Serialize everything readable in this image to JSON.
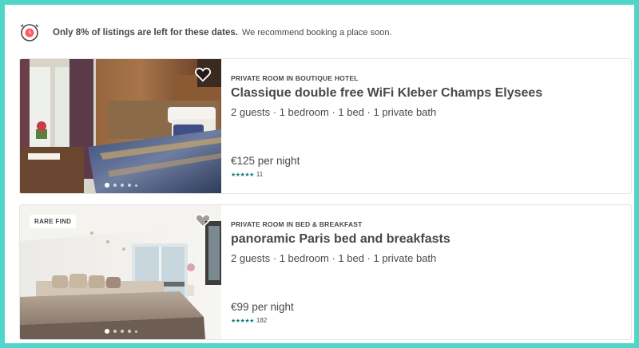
{
  "notice": {
    "icon": "clock-alert-icon",
    "strong": "Only 8% of listings are left for these dates.",
    "text": "We recommend booking a place soon."
  },
  "listings": [
    {
      "kind": "PRIVATE ROOM IN BOUTIQUE HOTEL",
      "title": "Classique double free WiFi Kleber Champs Elysees",
      "specs": "2 guests · 1 bedroom · 1 bed · 1 private bath",
      "price": "€125 per night",
      "stars": "★★★★★",
      "rating": 4.5,
      "reviews": "11",
      "badge": ""
    },
    {
      "kind": "PRIVATE ROOM IN BED & BREAKFAST",
      "title": "panoramic Paris bed and breakfasts",
      "specs": "2 guests · 1 bedroom · 1 bed · 1 private bath",
      "price": "€99 per night",
      "stars": "★★★★★",
      "rating": 5,
      "reviews": "182",
      "badge": "RARE FIND"
    }
  ],
  "colors": {
    "frame": "#4fd6c9",
    "star": "#0b7e7b",
    "alert": "#ff5a5f"
  }
}
